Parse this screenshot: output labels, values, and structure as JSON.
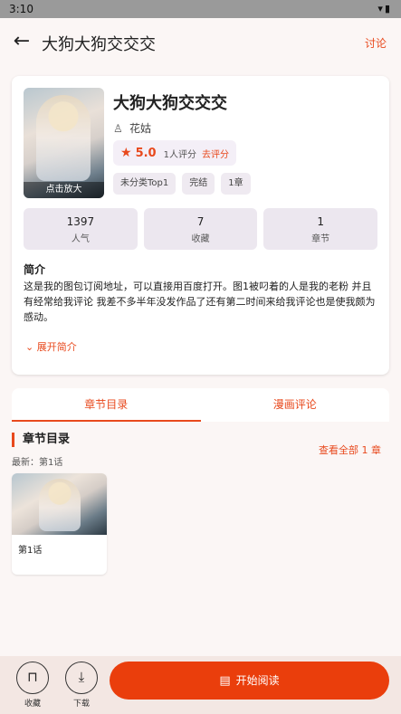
{
  "status_bar": {
    "time": "3:10",
    "icons": [
      "wifi-icon",
      "battery-icon"
    ]
  },
  "app_bar": {
    "title": "大狗大狗交交交",
    "comment_link": "讨论"
  },
  "book": {
    "cover_zoom_label": "点击放大",
    "title": "大狗大狗交交交",
    "author": "花姑",
    "score": "5.0",
    "rating_count": "1人评分",
    "rate_link": "去评分",
    "tags": [
      "未分类Top1",
      "完结",
      "1章"
    ]
  },
  "stats": [
    {
      "value": "1397",
      "label": "人气"
    },
    {
      "value": "7",
      "label": "收藏"
    },
    {
      "value": "1",
      "label": "章节"
    }
  ],
  "intro": {
    "heading": "简介",
    "text": "这是我的图包订阅地址，可以直接用百度打开。图1被叼着的人是我的老粉 并且有经常给我评论 我差不多半年没发作品了还有第二时间来给我评论也是使我颇为感动。",
    "expand_label": "展开简介"
  },
  "tabs": [
    {
      "label": "章节目录",
      "active": true
    },
    {
      "label": "漫画评论",
      "active": false
    }
  ],
  "toc": {
    "title": "章节目录",
    "latest": "最新：第1话",
    "view_all": "查看全部 1 章",
    "chapters": [
      {
        "name": "第1话"
      }
    ]
  },
  "bottom_bar": {
    "favorite_label": "收藏",
    "download_label": "下载",
    "read_label": "开始阅读"
  },
  "colors": {
    "accent": "#e8491d",
    "read_button": "#ea3e0c",
    "stat_bg": "#ece7ef",
    "page_bg": "#fbf6f5"
  }
}
